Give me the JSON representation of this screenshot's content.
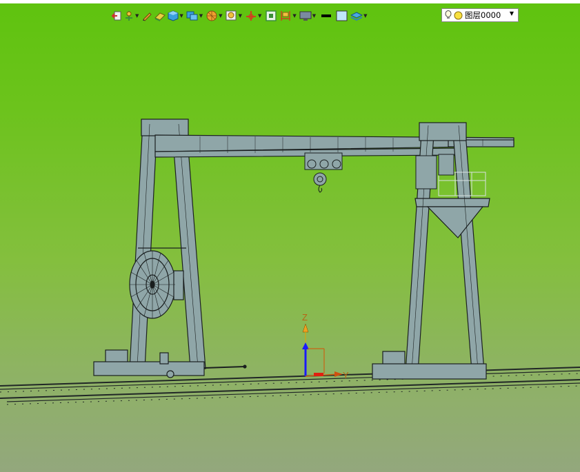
{
  "toolbar": {
    "items": [
      {
        "name": "exit-icon",
        "has_dropdown": false
      },
      {
        "name": "snap-icon",
        "has_dropdown": true
      },
      {
        "name": "pencil-icon",
        "has_dropdown": false
      },
      {
        "name": "eraser-icon",
        "has_dropdown": false
      },
      {
        "name": "cube-icon",
        "has_dropdown": true
      },
      {
        "name": "view-cube-icon",
        "has_dropdown": true
      },
      {
        "name": "render-sphere-icon",
        "has_dropdown": true
      },
      {
        "name": "zoom-window-icon",
        "has_dropdown": true
      },
      {
        "name": "pan-axis-icon",
        "has_dropdown": true
      },
      {
        "name": "frame-icon",
        "has_dropdown": false
      },
      {
        "name": "dimension-icon",
        "has_dropdown": true
      },
      {
        "name": "display-icon",
        "has_dropdown": true
      },
      {
        "name": "line-weight-icon",
        "has_dropdown": false
      },
      {
        "name": "color-swatch-icon",
        "has_dropdown": false
      },
      {
        "name": "layers-icon",
        "has_dropdown": true
      }
    ]
  },
  "layer": {
    "current": "图层0000",
    "on": true
  },
  "axes": {
    "z_label": "Z",
    "y_label": "Y",
    "z_color": "#1a1aff",
    "y_color": "#c86414"
  },
  "colors": {
    "steel": "#8fa6a8",
    "outline": "#1a1f1f",
    "accent_rail": "#2a2a2a"
  }
}
